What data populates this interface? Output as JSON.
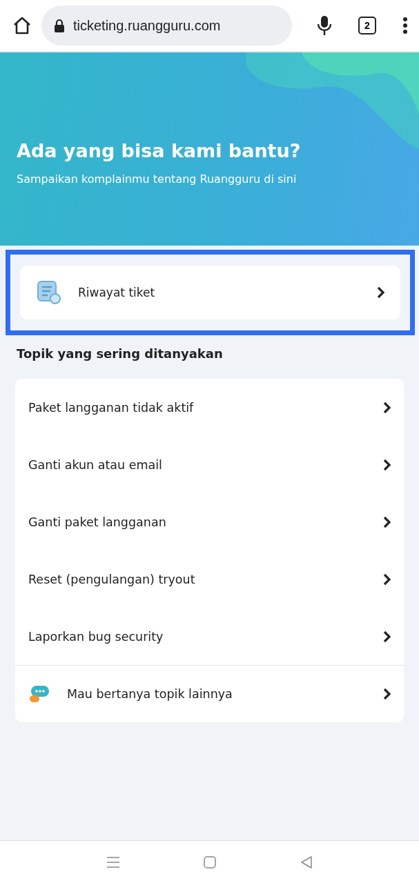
{
  "browser": {
    "url": "ticketing.ruangguru.com",
    "tab_count": "2"
  },
  "hero": {
    "title": "Ada yang bisa kami bantu?",
    "subtitle": "Sampaikan komplainmu tentang Ruangguru di sini"
  },
  "history": {
    "label": "Riwayat tiket",
    "highlighted": true
  },
  "topics_heading": "Topik yang sering ditanyakan",
  "topics": [
    {
      "kind": "topic",
      "label": "Paket langganan tidak aktif"
    },
    {
      "kind": "topic",
      "label": "Ganti akun atau email"
    },
    {
      "kind": "topic",
      "label": "Ganti paket langganan"
    },
    {
      "kind": "topic",
      "label": "Reset (pengulangan) tryout"
    },
    {
      "kind": "topic",
      "label": "Laporkan bug security"
    },
    {
      "kind": "chat",
      "label": "Mau bertanya topik lainnya"
    }
  ]
}
